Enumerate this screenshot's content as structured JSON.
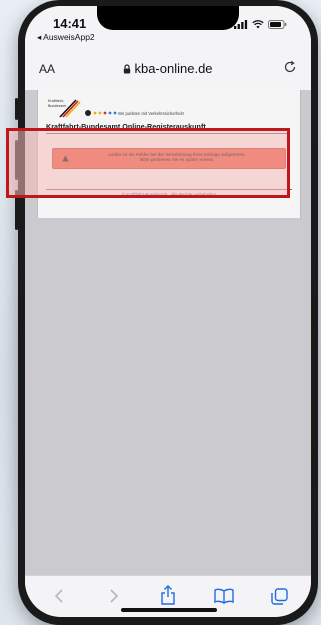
{
  "status_bar": {
    "time": "14:41",
    "back_app": "◂ AusweisApp2"
  },
  "browser": {
    "text_size_button": "AA",
    "domain": "kba-online.de",
    "lock_icon": "lock-icon",
    "reload_icon": "reload-icon"
  },
  "site": {
    "logo_text": "Kraftfahrt-\nBundesamt",
    "tagline": "Wir punkten mit Verkehrssicherheit!",
    "title": "Kraftfahrt-Bundesamt Online-Registerauskunft",
    "error_line1": "Leider ist ein Fehler bei der Verarbeitung Ihrer Anfrage aufgetreten.",
    "error_line2": "Bitte probieren Sie es später erneut.",
    "footer_prefix": "© ",
    "footer_link": "Kraftfahrt-Bundesamt",
    "footer_suffix": " , alle Rechte vorbehalten"
  },
  "colors": {
    "error_bg": "#e8523a",
    "highlight_border": "#c0171a",
    "link": "#1a3fa8"
  },
  "toolbar": {
    "icons": [
      "back-icon",
      "forward-icon",
      "share-icon",
      "bookmarks-icon",
      "tabs-icon"
    ]
  }
}
